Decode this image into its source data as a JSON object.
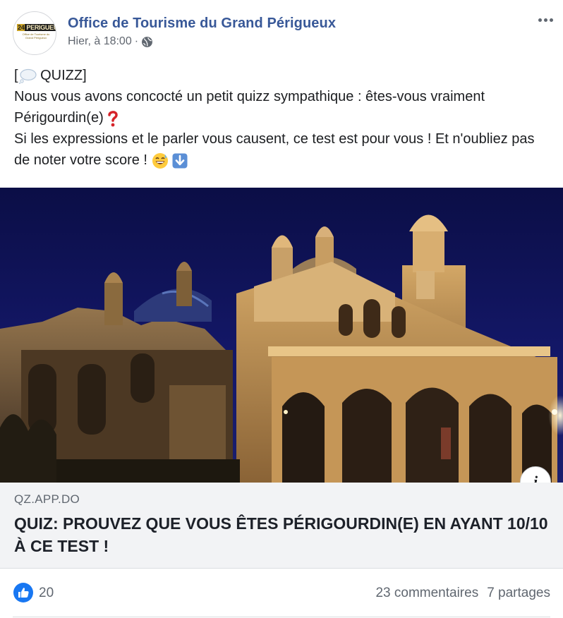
{
  "post": {
    "page_name": "Office de Tourisme du Grand Périgueux",
    "avatar_logo": {
      "number": "24",
      "word": "PERIGUEUX",
      "subtitle": "Office de Tourisme du Grand Périgueux"
    },
    "timestamp": "Hier, à 18:00",
    "audience_icon": "globe-icon",
    "more_icon": "more-options-icon",
    "text_line1_prefix": "[",
    "text_line1_label": "QUIZZ]",
    "text_para": "Nous vous avons concocté un petit quizz sympathique : êtes-vous vraiment Périgourdin(e)",
    "text_para2": "Si les expressions et le parler vous causent, ce test est pour vous ! Et n'oubliez pas de noter votre score !",
    "emojis": [
      "thought-balloon-icon",
      "red-question-mark-icon",
      "grinning-sweat-face-icon",
      "down-arrow-icon"
    ]
  },
  "link": {
    "domain": "QZ.APP.DO",
    "headline": "QUIZ: PROUVEZ QUE VOUS ÊTES PÉRIGOURDIN(E) EN AYANT 10/10 À CE TEST !",
    "info_label": "i",
    "image_subject": "cathedral-photo"
  },
  "reactions": {
    "likes": "20",
    "comments": "23 commentaires",
    "shares": "7 partages"
  },
  "colors": {
    "brand": "#385898",
    "like_blue": "#1877f2",
    "card_bg": "#f2f3f5",
    "secondary_text": "#606770"
  }
}
